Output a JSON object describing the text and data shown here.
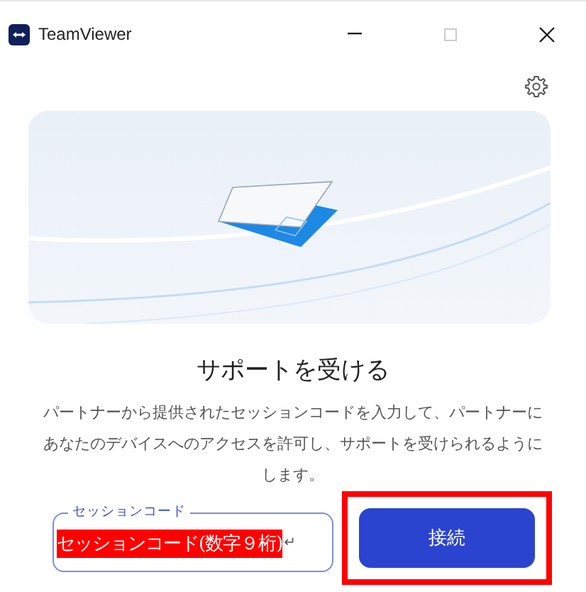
{
  "window": {
    "title": "TeamViewer"
  },
  "heading": "サポートを受ける",
  "description": "パートナーから提供されたセッションコードを入力して、パートナーにあなたのデバイスへのアクセスを許可し、サポートを受けられるようにします。",
  "session_field": {
    "label": "セッションコード",
    "value": "セッションコード(数字９桁)",
    "return_mark": "↵"
  },
  "connect_button": {
    "label": "接続",
    "highlighted": true
  }
}
